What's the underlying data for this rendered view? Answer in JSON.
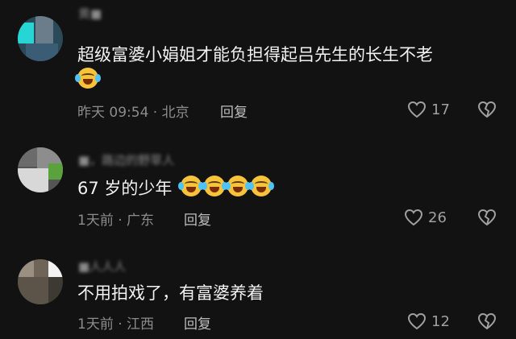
{
  "comments": [
    {
      "username": "黄■",
      "text": "超级富婆小娟姐才能负担得起吕先生的长生不老",
      "emoji_count": 1,
      "meta": "昨天 09:54 · 北京",
      "reply_label": "回复",
      "likes": "17"
    },
    {
      "username": "■，路边的野草人",
      "text": "67 岁的少年",
      "emoji_count": 4,
      "meta": "1天前 · 广东",
      "reply_label": "回复",
      "likes": "26"
    },
    {
      "username": "■人人人",
      "text": "不用拍戏了，有富婆养着",
      "emoji_count": 0,
      "meta": "1天前 · 江西",
      "reply_label": "回复",
      "likes": "12"
    }
  ],
  "colors": {
    "background": "#121212",
    "text": "#f2f2f2",
    "meta": "#8c8c8c",
    "emoji": "#f6c33b"
  },
  "icons": {
    "like": "heart-outline-icon",
    "dislike": "broken-heart-icon",
    "emoji": "laughing-crying-emoji-icon"
  }
}
